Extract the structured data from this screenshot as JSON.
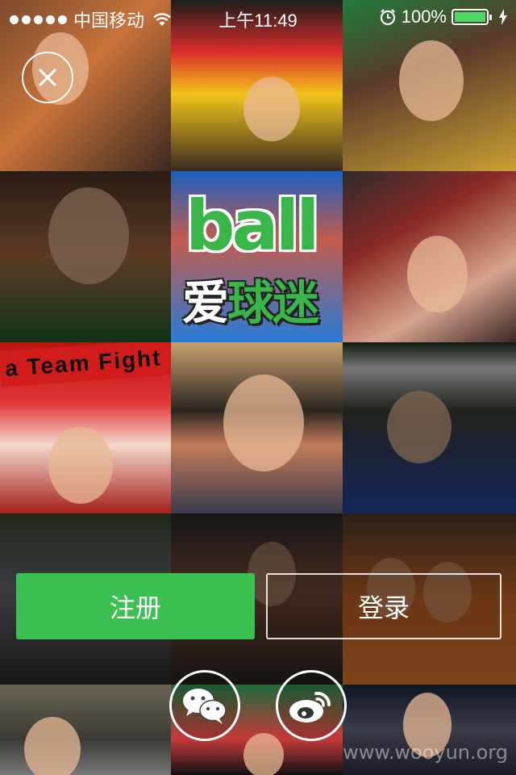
{
  "status_bar": {
    "carrier": "中国移动",
    "time": "上午11:49",
    "battery": "100%",
    "signal_icon": "signal-dots-icon",
    "wifi_icon": "wifi-icon",
    "alarm_icon": "alarm-clock-icon",
    "charging_icon": "charging-bolt-icon"
  },
  "logo": {
    "latin": "ball",
    "chinese_white": "爱",
    "chinese_green": "球迷"
  },
  "scarf_text": "a Team Fight",
  "actions": {
    "register_label": "注册",
    "login_label": "登录"
  },
  "social": {
    "wechat_icon": "wechat-icon",
    "weibo_icon": "weibo-icon"
  },
  "close_icon": "close-icon",
  "watermark": "www.wooyun.org",
  "colors": {
    "accent_green": "#3bc151",
    "battery_green": "#4cd964",
    "text": "#ffffff"
  }
}
